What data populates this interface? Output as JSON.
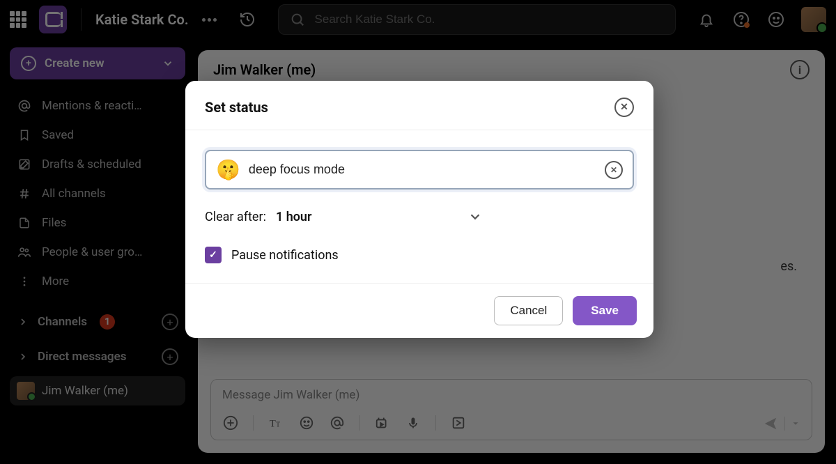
{
  "topbar": {
    "workspace_name": "Katie Stark Co.",
    "search_placeholder": "Search Katie Stark Co."
  },
  "sidebar": {
    "create_label": "Create new",
    "items": [
      {
        "icon": "at",
        "label": "Mentions & reacti…"
      },
      {
        "icon": "bookmark",
        "label": "Saved"
      },
      {
        "icon": "draft",
        "label": "Drafts & scheduled"
      },
      {
        "icon": "channels",
        "label": "All channels"
      },
      {
        "icon": "file",
        "label": "Files"
      },
      {
        "icon": "people",
        "label": "People & user gro…"
      },
      {
        "icon": "more",
        "label": "More"
      }
    ],
    "channels_label": "Channels",
    "channels_badge": "1",
    "dms_label": "Direct messages",
    "self_dm": "Jim Walker (me)"
  },
  "main": {
    "header_title": "Jim Walker (me)",
    "body_snippet": "es.",
    "composer_placeholder": "Message Jim Walker (me)"
  },
  "modal": {
    "title": "Set status",
    "status_emoji": "🤫",
    "status_value": "deep focus mode",
    "clear_label": "Clear after:",
    "clear_value": "1 hour",
    "pause_label": "Pause notifications",
    "pause_checked": true,
    "cancel_label": "Cancel",
    "save_label": "Save"
  },
  "colors": {
    "accent": "#6b3fa0",
    "save_button": "#8457c7",
    "badge": "#d9381e",
    "online": "#4caf50"
  }
}
